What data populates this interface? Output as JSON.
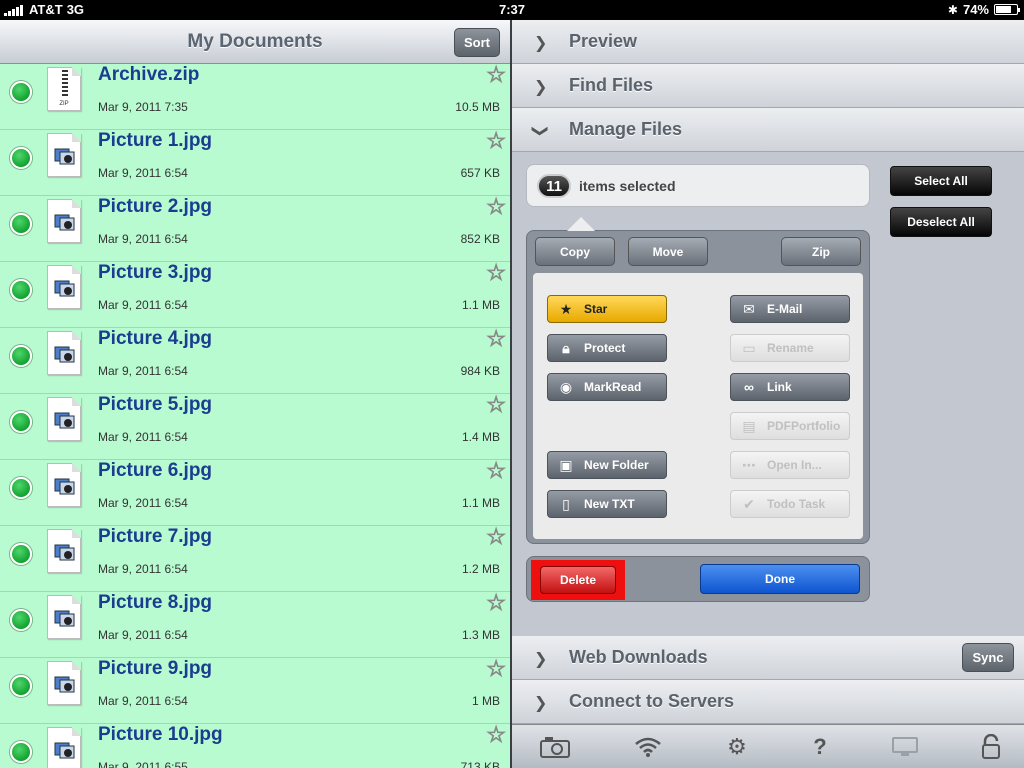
{
  "status": {
    "carrier": "AT&T",
    "network": "3G",
    "time": "7:37",
    "battery": "74%",
    "battery_level": 0.74
  },
  "left": {
    "title": "My Documents",
    "sort_label": "Sort",
    "files": [
      {
        "name": "Archive.zip",
        "date": "Mar 9, 2011 7:35",
        "size": "10.5 MB",
        "kind": "zip",
        "zip_text": "ZIP"
      },
      {
        "name": "Picture 1.jpg",
        "date": "Mar 9, 2011 6:54",
        "size": "657 KB",
        "kind": "image"
      },
      {
        "name": "Picture 2.jpg",
        "date": "Mar 9, 2011 6:54",
        "size": "852 KB",
        "kind": "image"
      },
      {
        "name": "Picture 3.jpg",
        "date": "Mar 9, 2011 6:54",
        "size": "1.1 MB",
        "kind": "image"
      },
      {
        "name": "Picture 4.jpg",
        "date": "Mar 9, 2011 6:54",
        "size": "984 KB",
        "kind": "image"
      },
      {
        "name": "Picture 5.jpg",
        "date": "Mar 9, 2011 6:54",
        "size": "1.4 MB",
        "kind": "image"
      },
      {
        "name": "Picture 6.jpg",
        "date": "Mar 9, 2011 6:54",
        "size": "1.1 MB",
        "kind": "image"
      },
      {
        "name": "Picture 7.jpg",
        "date": "Mar 9, 2011 6:54",
        "size": "1.2 MB",
        "kind": "image"
      },
      {
        "name": "Picture 8.jpg",
        "date": "Mar 9, 2011 6:54",
        "size": "1.3 MB",
        "kind": "image"
      },
      {
        "name": "Picture 9.jpg",
        "date": "Mar 9, 2011 6:54",
        "size": "1 MB",
        "kind": "image"
      },
      {
        "name": "Picture 10.jpg",
        "date": "Mar 9, 2011 6:55",
        "size": "713 KB",
        "kind": "image"
      }
    ]
  },
  "right": {
    "sections": {
      "preview": "Preview",
      "find": "Find Files",
      "manage": "Manage Files",
      "web": "Web Downloads",
      "connect": "Connect to Servers"
    },
    "sync_label": "Sync",
    "selection": {
      "count": "11",
      "text": "items selected"
    },
    "select_all": "Select All",
    "deselect_all": "Deselect All",
    "top_actions": {
      "copy": "Copy",
      "move": "Move",
      "zip": "Zip"
    },
    "ops": {
      "star": "Star",
      "email": "E-Mail",
      "protect": "Protect",
      "rename": "Rename",
      "markread": "MarkRead",
      "link": "Link",
      "pdfportfolio": "PDFPortfolio",
      "newfolder": "New Folder",
      "openin": "Open In...",
      "newtxt": "New TXT",
      "todo": "Todo Task"
    },
    "delete_label": "Delete",
    "done_label": "Done"
  },
  "colors": {
    "list_bg": "#b9fbd0",
    "status_dot": "#1fb33f",
    "name_text": "#1a3d8f",
    "delete_red": "#ee0f0f",
    "done_blue": "#1c63d9",
    "star_yellow": "#f5c21b"
  },
  "icons": [
    "signal-icon",
    "bluetooth-icon",
    "battery-icon",
    "star-outline-icon",
    "zip-file-icon",
    "image-file-icon",
    "chevron-right-icon",
    "chevron-down-icon",
    "camera-icon",
    "wifi-icon",
    "gear-icon",
    "help-icon",
    "monitor-icon",
    "lock-icon"
  ]
}
